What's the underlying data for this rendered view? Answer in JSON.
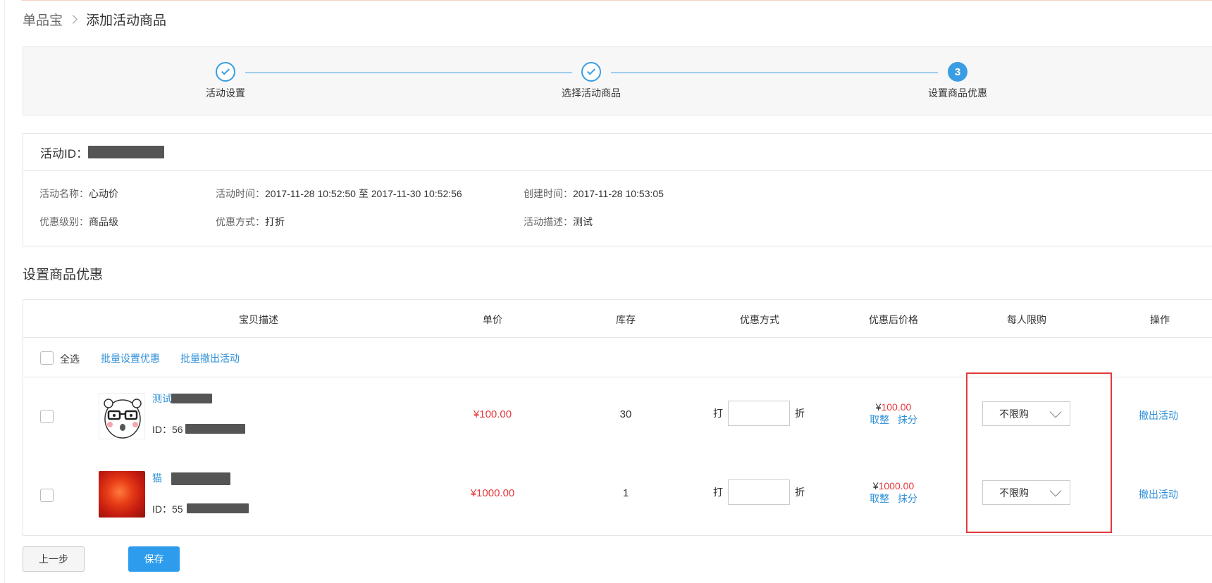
{
  "breadcrumb": {
    "root": "单品宝",
    "current": "添加活动商品"
  },
  "steps": [
    {
      "label": "活动设置",
      "state": "done"
    },
    {
      "label": "选择活动商品",
      "state": "done"
    },
    {
      "label": "设置商品优惠",
      "state": "active",
      "number": "3"
    }
  ],
  "activity": {
    "id_label": "活动ID：",
    "name_label": "活动名称：",
    "name": "心动价",
    "time_label": "活动时间：",
    "time": "2017-11-28 10:52:50 至 2017-11-30 10:52:56",
    "created_label": "创建时间：",
    "created": "2017-11-28 10:53:05",
    "level_label": "优惠级别：",
    "level": "商品级",
    "method_label": "优惠方式：",
    "method": "打折",
    "desc_label": "活动描述：",
    "desc": "测试"
  },
  "section_title": "设置商品优惠",
  "table": {
    "columns": [
      "宝贝描述",
      "单价",
      "库存",
      "优惠方式",
      "优惠后价格",
      "每人限购",
      "操作"
    ],
    "select_all": "全选",
    "bulk_set": "批量设置优惠",
    "bulk_remove": "批量撤出活动",
    "rows": [
      {
        "title": "测试",
        "id": "ID：56",
        "price": "¥100.00",
        "stock": "30",
        "disc_prefix": "打",
        "disc_suffix": "折",
        "after_yen": "¥",
        "after_value": "100.00",
        "round": "取整",
        "trim": "抹分",
        "limit": "不限购",
        "action": "撤出活动"
      },
      {
        "title": "猫",
        "id": "ID：55",
        "price": "¥1000.00",
        "stock": "1",
        "disc_prefix": "打",
        "disc_suffix": "折",
        "after_yen": "¥",
        "after_value": "1000.00",
        "round": "取整",
        "trim": "抹分",
        "limit": "不限购",
        "action": "撤出活动"
      }
    ]
  },
  "buttons": {
    "prev": "上一步",
    "save": "保存"
  },
  "colors": {
    "accent": "#2d9cec",
    "price": "#e4393c",
    "highlight": "#e03b3b"
  }
}
